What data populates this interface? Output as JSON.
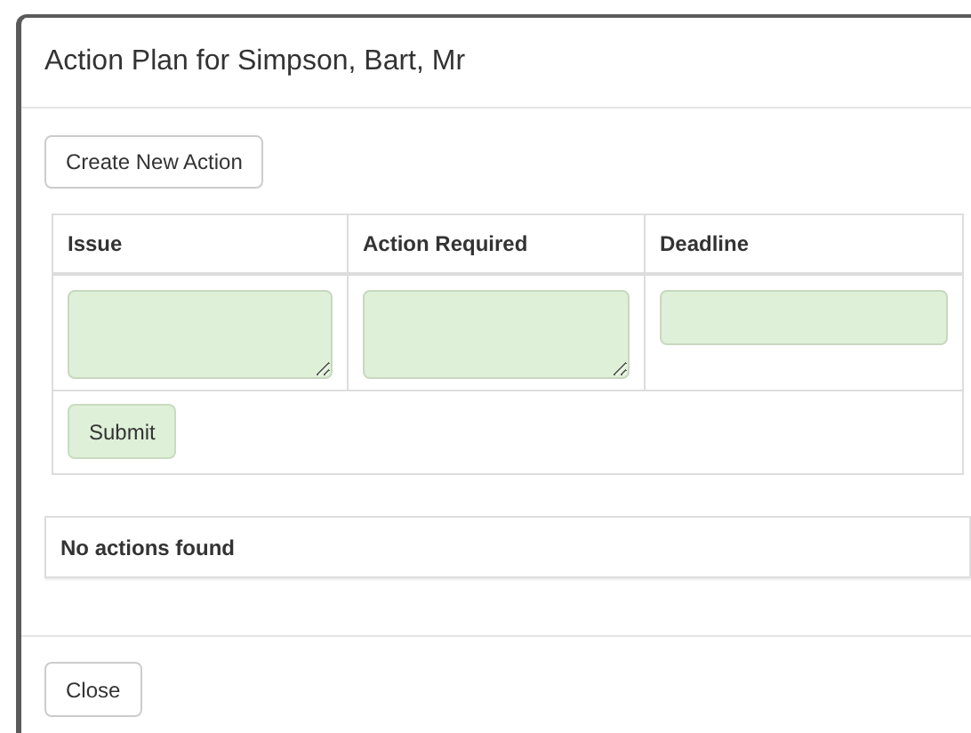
{
  "modal": {
    "title": "Action Plan for Simpson, Bart, Mr"
  },
  "create_button": "Create New Action",
  "table": {
    "columns": [
      "Issue",
      "Action Required",
      "Deadline"
    ],
    "inputs": [
      {
        "kind": "textarea"
      },
      {
        "kind": "textarea"
      },
      {
        "kind": "input"
      }
    ],
    "submit_button": "Submit"
  },
  "empty_message": "No actions found",
  "close_button": "Close"
}
